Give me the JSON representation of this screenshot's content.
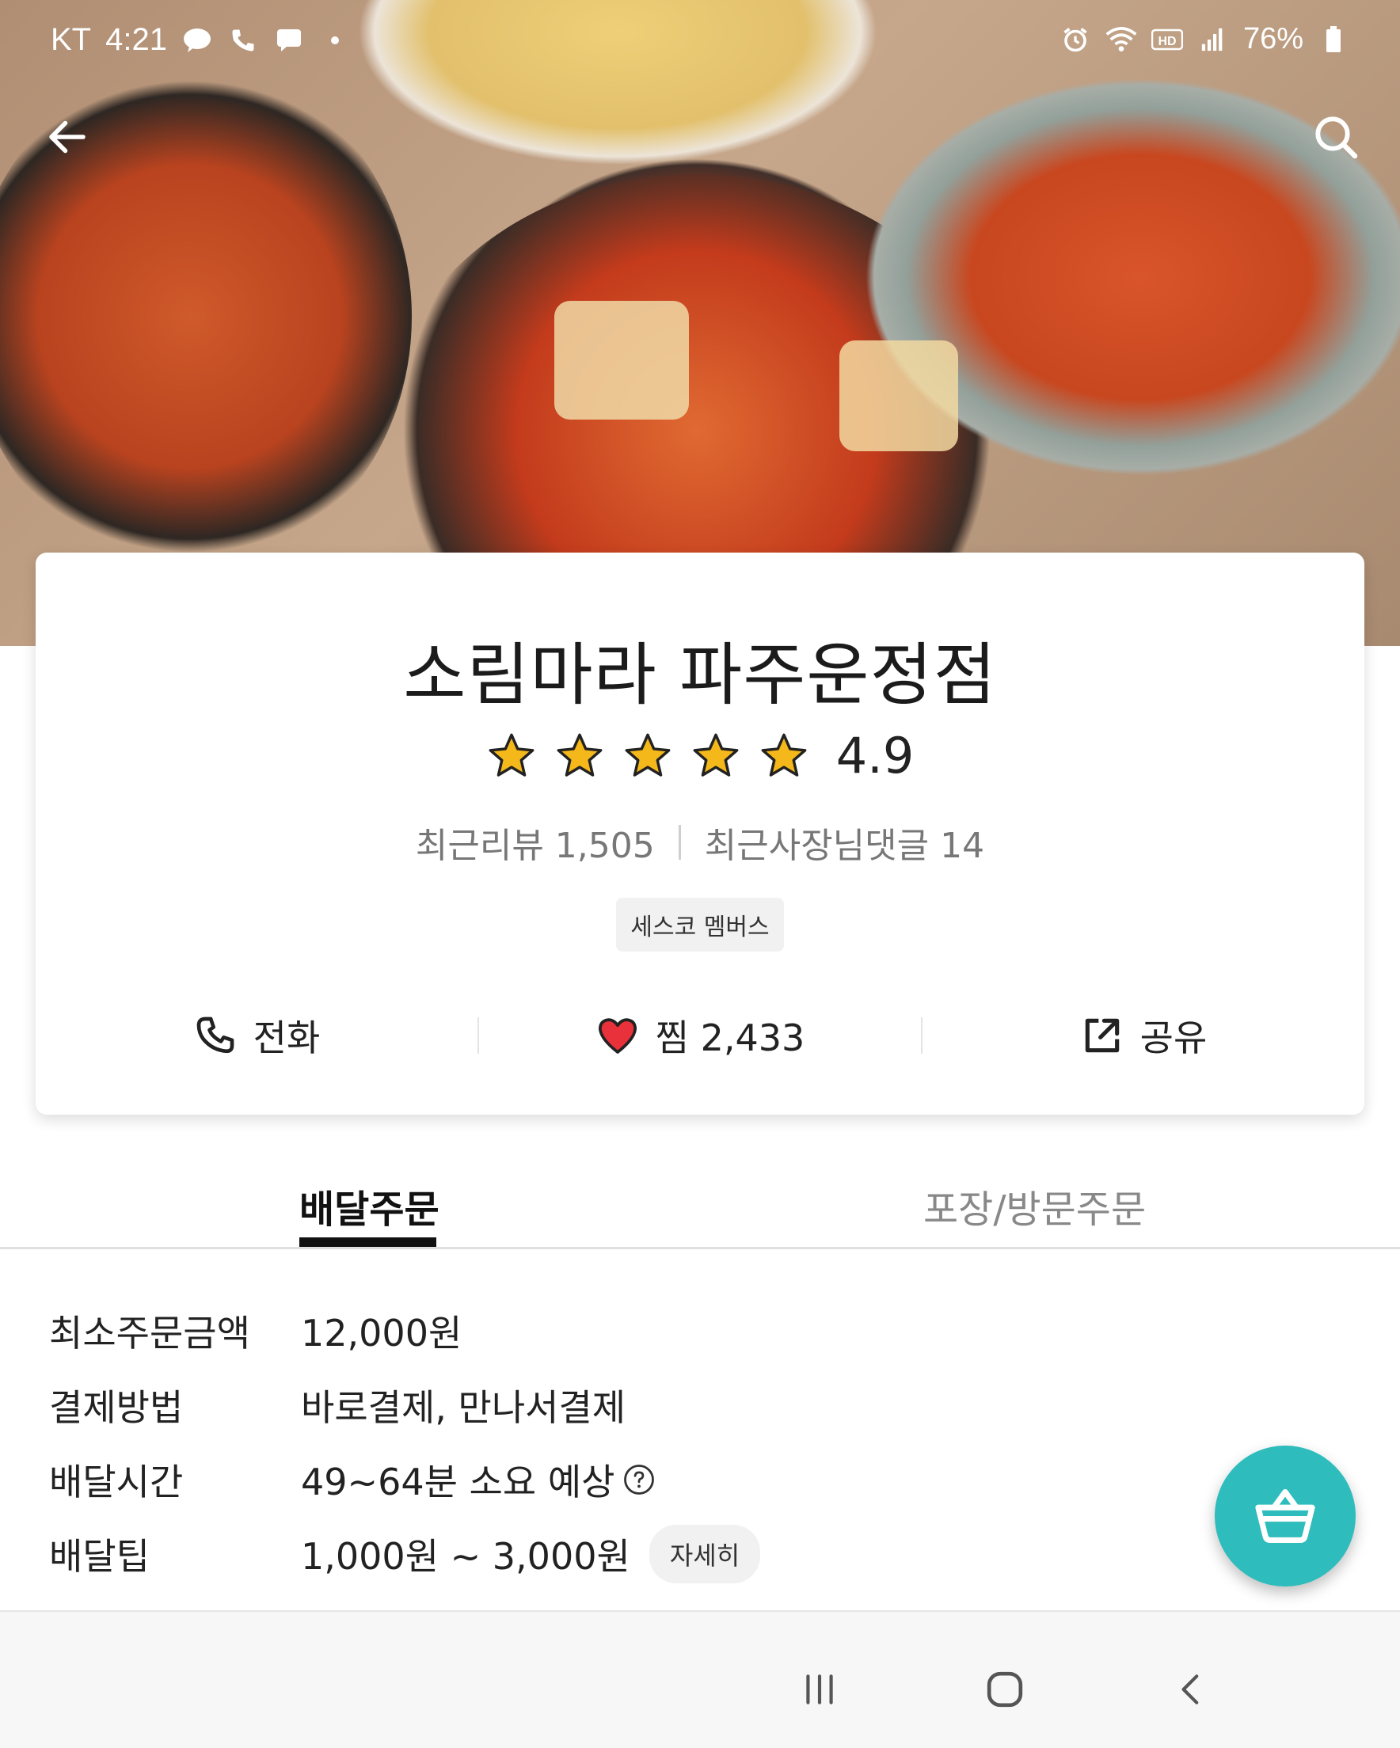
{
  "status_bar": {
    "carrier": "KT",
    "time": "4:21",
    "battery": "76%"
  },
  "store": {
    "name": "소림마라 파주운정점",
    "rating": "4.9",
    "stars": 5,
    "recent_reviews": "최근리뷰 1,505",
    "owner_replies": "최근사장님댓글 14",
    "badge": "세스코 멤버스"
  },
  "actions": {
    "call": "전화",
    "like": "찜 2,433",
    "share": "공유"
  },
  "tabs": {
    "delivery": "배달주문",
    "pickup": "포장/방문주문"
  },
  "info": [
    {
      "label": "최소주문금액",
      "value": "12,000원"
    },
    {
      "label": "결제방법",
      "value": "바로결제, 만나서결제"
    },
    {
      "label": "배달시간",
      "value": "49~64분 소요 예상"
    },
    {
      "label": "배달팁",
      "value": "1,000원 ~ 3,000원"
    }
  ],
  "detail_button": "자세히",
  "colors": {
    "accent": "#2ebcbc",
    "star": "#f5b81b",
    "heart": "#e8313a"
  }
}
